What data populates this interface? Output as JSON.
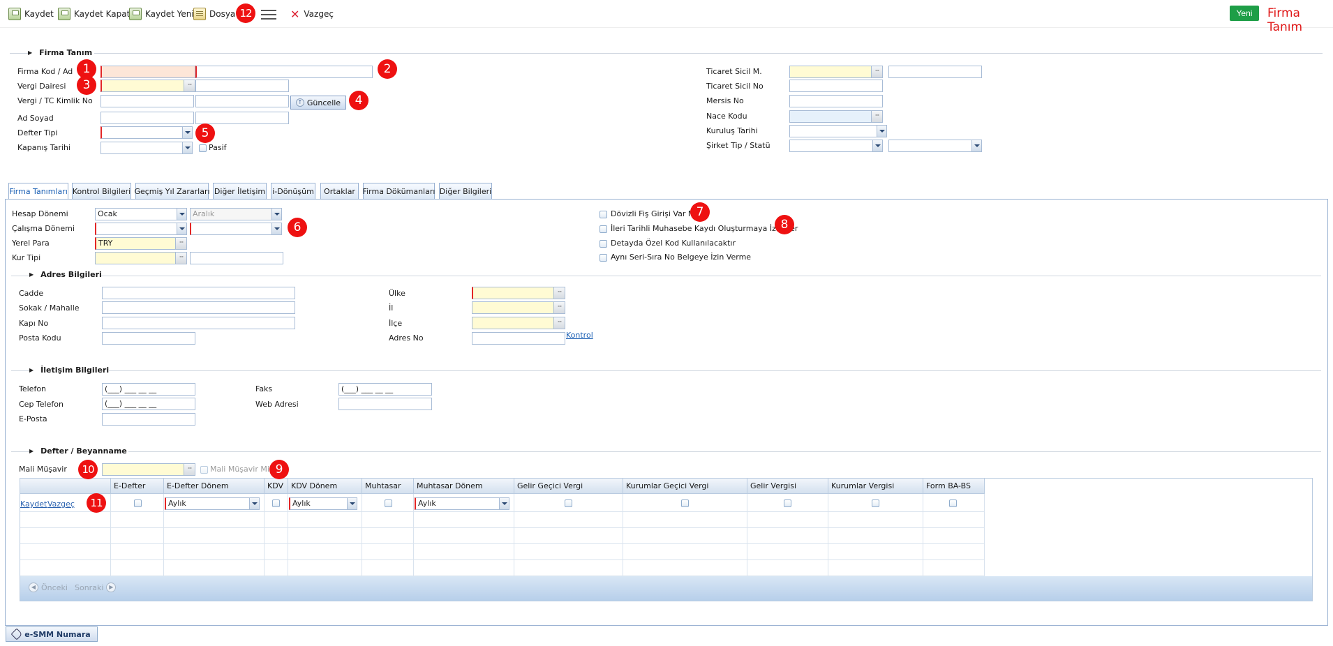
{
  "toolbar": {
    "save": "Kaydet",
    "save_close": "Kaydet Kapat",
    "save_new": "Kaydet Yeni",
    "file": "Dosya",
    "cancel": "Vazgeç",
    "new": "Yeni",
    "title": "Firma Tanım"
  },
  "badges": [
    "1",
    "2",
    "3",
    "4",
    "5",
    "6",
    "7",
    "8",
    "9",
    "10",
    "11",
    "12"
  ],
  "firma": {
    "section_title": "Firma Tanım",
    "labels": {
      "kod_ad": "Firma Kod / Ad",
      "vergi_dairesi": "Vergi Dairesi",
      "vergi_tc": "Vergi / TC Kimlik No",
      "ad_soyad": "Ad Soyad",
      "defter_tipi": "Defter Tipi",
      "kapanis": "Kapanış Tarihi",
      "pasif": "Pasif",
      "ticaret_sicil_m": "Ticaret Sicil M.",
      "ticaret_sicil_no": "Ticaret Sicil No",
      "mersis": "Mersis No",
      "nace": "Nace Kodu",
      "kurulus": "Kuruluş Tarihi",
      "sirket_tip": "Şirket Tip / Statü"
    },
    "guncelle": "Güncelle"
  },
  "tabs": [
    "Firma Tanımları",
    "Kontrol Bilgileri",
    "Geçmiş Yıl Zararları",
    "Diğer İletişim",
    "i-Dönüşüm",
    "Ortaklar",
    "Firma Dökümanları",
    "Diğer Bilgileri"
  ],
  "tanim": {
    "hesap_donemi": "Hesap Dönemi",
    "hesap_start": "Ocak",
    "hesap_end": "Aralık",
    "calisma_donemi": "Çalışma Dönemi",
    "yerel_para": "Yerel Para",
    "yerel_para_val": "TRY",
    "kur_tipi": "Kur Tipi",
    "dovizli": "Dövizli Fiş Girişi Var Mı?",
    "ileri_tarihli": "İleri Tarihli Muhasebe Kaydı Oluşturmaya İzin Ver",
    "ozel_kod": "Detayda Özel Kod Kullanılacaktır",
    "seri_sira": "Aynı Seri-Sıra No Belgeye İzin Verme"
  },
  "adres": {
    "title": "Adres Bilgileri",
    "cadde": "Cadde",
    "sokak": "Sokak / Mahalle",
    "kapi": "Kapı No",
    "posta": "Posta Kodu",
    "ulke": "Ülke",
    "il": "İl",
    "ilce": "İlçe",
    "adres_no": "Adres No",
    "kontrol": "Kontrol"
  },
  "iletisim": {
    "title": "İletişim Bilgileri",
    "telefon": "Telefon",
    "cep": "Cep Telefon",
    "eposta": "E-Posta",
    "faks": "Faks",
    "web": "Web Adresi",
    "phone_mask": "(___) ___ __ __"
  },
  "defter": {
    "title": "Defter / Beyanname",
    "mali_musavir": "Mali Müşavir",
    "mali_musavir_mi": "Mali Müşavir Mi?",
    "columns": [
      "",
      "E-Defter",
      "E-Defter Dönem",
      "KDV",
      "KDV Dönem",
      "Muhtasar",
      "Muhtasar Dönem",
      "Gelir Geçici Vergi",
      "Kurumlar Geçici Vergi",
      "Gelir Vergisi",
      "Kurumlar Vergisi",
      "Form BA-BS"
    ],
    "row_save": "Kaydet",
    "row_cancel": "Vazgeç",
    "period": "Aylık",
    "prev": "Önceki",
    "next": "Sonraki"
  },
  "esmm": "e-SMM Numara"
}
